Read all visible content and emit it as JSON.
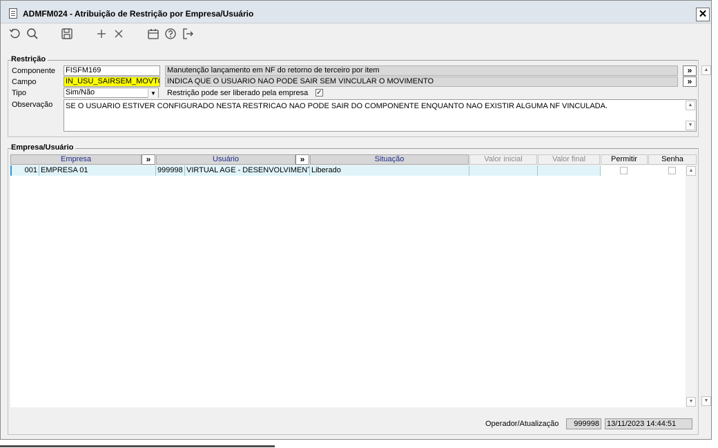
{
  "window": {
    "title": "ADMFM024 - Atribuição de Restrição por Empresa/Usuário",
    "close_label": "✕"
  },
  "toolbar": {
    "icons": [
      "refresh-icon",
      "search-icon",
      "save-icon",
      "add-icon",
      "delete-icon",
      "calendar-icon",
      "help-icon",
      "exit-icon"
    ]
  },
  "restricao": {
    "group_label": "Restrição",
    "componente_label": "Componente",
    "componente_value": "FISFM169",
    "componente_desc": "Manutenção lançamento em NF do retorno de terceiro por item",
    "campo_label": "Campo",
    "campo_value": "IN_USU_SAIRSEM_MOVTO",
    "campo_desc": "INDICA QUE O USUARIO NAO PODE SAIR SEM VINCULAR O MOVIMENTO",
    "tipo_label": "Tipo",
    "tipo_value": "Sim/Não",
    "liberado_label": "Restrição pode ser liberado pela empresa",
    "liberado_checked": true,
    "observacao_label": "Observação",
    "observacao_value": "SE O USUARIO ESTIVER CONFIGURADO NESTA RESTRICAO NAO PODE SAIR DO COMPONENTE ENQUANTO NAO EXISTIR ALGUMA NF VINCULADA.",
    "expand_button": "»"
  },
  "empresa_usuario": {
    "group_label": "Empresa/Usuário",
    "columns": {
      "empresa": "Empresa",
      "usuario": "Usuário",
      "situacao": "Situação",
      "valor_inicial": "Valor inicial",
      "valor_final": "Valor final",
      "permitir": "Permitir",
      "senha": "Senha"
    },
    "expand_button": "»",
    "rows": [
      {
        "empresa_code": "001",
        "empresa_name": "EMPRESA 01",
        "usuario_code": "999998",
        "usuario_name": "VIRTUAL AGE - DESENVOLVIMENTO",
        "situacao": "Liberado",
        "valor_inicial": "",
        "valor_final": "",
        "permitir": false,
        "senha": false
      }
    ]
  },
  "footer": {
    "label": "Operador/Atualização",
    "operador": "999998",
    "atualizacao": "13/11/2023 14:44:51"
  }
}
